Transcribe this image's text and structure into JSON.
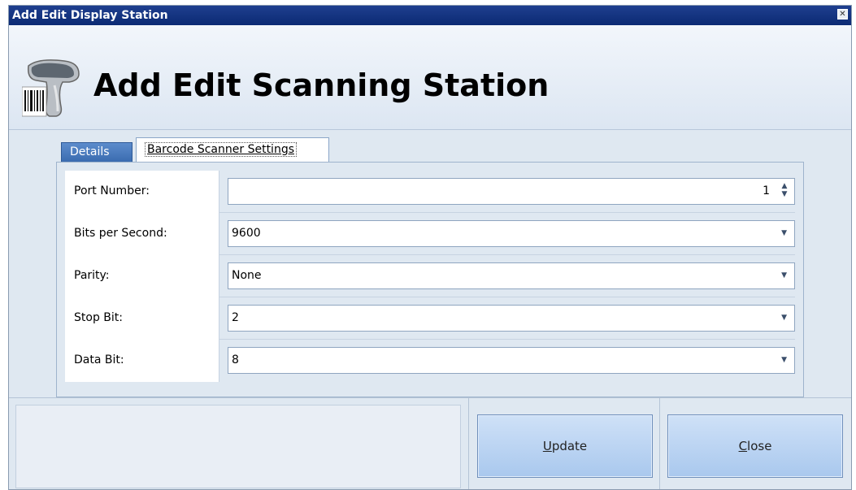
{
  "window": {
    "title": "Add Edit Display Station",
    "close_glyph": "✕"
  },
  "header": {
    "title": "Add Edit Scanning Station",
    "icon": "barcode-scanner-icon"
  },
  "tabs": [
    {
      "label": "Details",
      "selected": false
    },
    {
      "label": "Barcode Scanner Settings",
      "selected": true
    }
  ],
  "fields": [
    {
      "label": "Port Number:",
      "value": "1",
      "control": "spinner"
    },
    {
      "label": "Bits per Second:",
      "value": "9600",
      "control": "dropdown"
    },
    {
      "label": "Parity:",
      "value": "None",
      "control": "dropdown"
    },
    {
      "label": "Stop Bit:",
      "value": "2",
      "control": "dropdown"
    },
    {
      "label": "Data Bit:",
      "value": "8",
      "control": "dropdown"
    }
  ],
  "buttons": {
    "update_label": "Update",
    "close_label": "Close"
  },
  "colors": {
    "titlebar": "#0b2a73",
    "tab_active": "#3b6cb0",
    "button": "#a9c8ee"
  }
}
